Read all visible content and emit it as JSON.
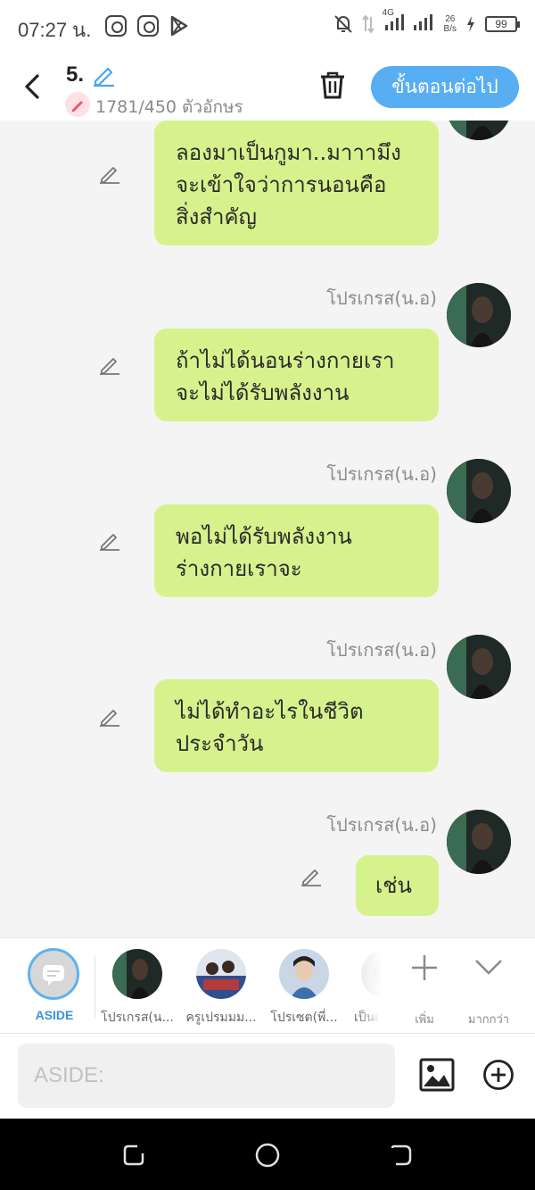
{
  "status_bar": {
    "time": "07:27 น.",
    "network_type": "4G",
    "speed_value": "26",
    "speed_unit": "B/s",
    "battery": "99",
    "icons": [
      "instagram-icon",
      "instagram-icon",
      "play-store-icon",
      "bell-off-icon",
      "data-arrows-icon",
      "signal-icon",
      "charging-icon",
      "battery-icon"
    ]
  },
  "header": {
    "title": "5.",
    "char_count": "1781/450 ตัวอักษร",
    "next_button": "ขั้นตอนต่อไป",
    "accent_color": "#58aef2"
  },
  "messages": [
    {
      "author": "",
      "text_lines": [
        "ลองมาเป็นกูมา..มาาามึง",
        "จะเข้าใจว่าการนอนคือ",
        "สิ่งสำคัญ"
      ]
    },
    {
      "author": "โปรเกรส(น.อ)",
      "text_lines": [
        "ถ้าไม่ได้นอนร่างกายเรา",
        "จะไม่ได้รับพลังงาน"
      ]
    },
    {
      "author": "โปรเกรส(น.อ)",
      "text_lines": [
        "พอไม่ได้รับพลังงาน",
        "ร่างกายเราจะ"
      ]
    },
    {
      "author": "โปรเกรส(น.อ)",
      "text_lines": [
        "ไม่ได้ทำอะไรในชีวิต",
        "ประจำวัน"
      ]
    },
    {
      "author": "โปรเกรส(น.อ)",
      "text_lines": [
        "เช่น"
      ]
    }
  ],
  "bubble_color": "#d6f28d",
  "characters": {
    "aside_label": "ASIDE",
    "items": [
      {
        "name": "โปรเกรส(น..."
      },
      {
        "name": "ครูเปรมมม..."
      },
      {
        "name": "โปรเซต(พี่..."
      },
      {
        "name": "เป็นเ"
      }
    ],
    "add_label": "เพิ่ม",
    "more_label": "มากกว่า"
  },
  "composer": {
    "placeholder": "ASIDE:",
    "value": ""
  }
}
